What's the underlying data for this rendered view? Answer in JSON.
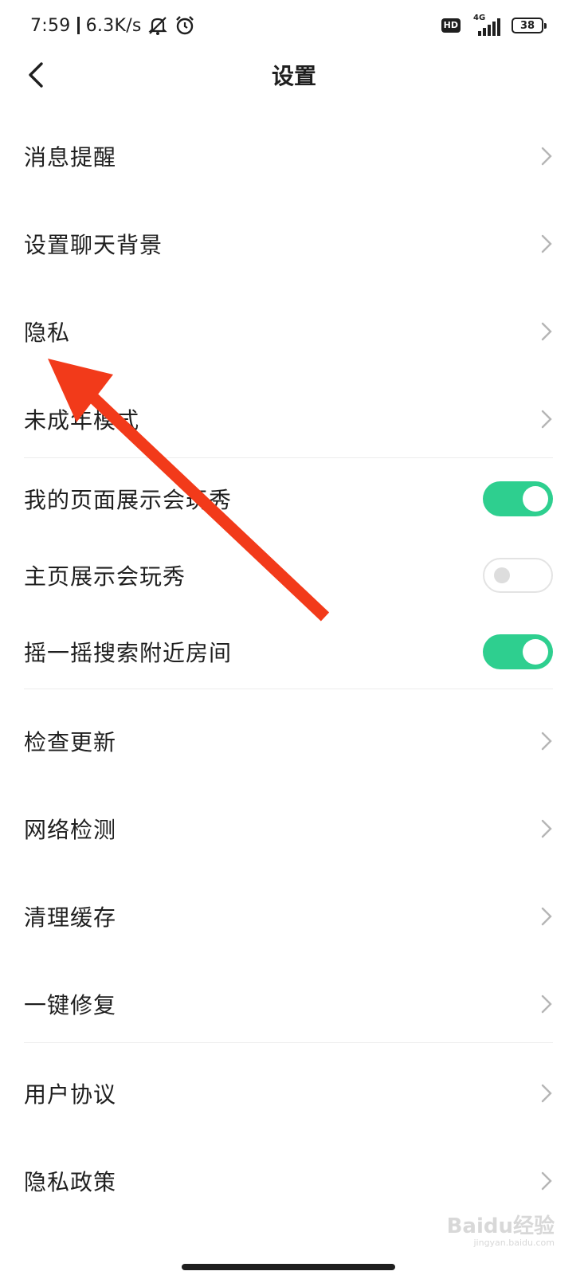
{
  "status_bar": {
    "time": "7:59",
    "net_speed": "6.3K/s",
    "hd_label": "HD",
    "network_type": "4G",
    "battery": "38",
    "icons": [
      "bell-off-icon",
      "alarm-icon",
      "signal-icon",
      "battery-icon"
    ]
  },
  "header": {
    "title": "设置",
    "back_icon": "chevron-left-icon"
  },
  "sections": [
    {
      "rows": [
        {
          "label": "消息提醒",
          "type": "link"
        },
        {
          "label": "设置聊天背景",
          "type": "link"
        },
        {
          "label": "隐私",
          "type": "link"
        },
        {
          "label": "未成年模式",
          "type": "link"
        }
      ]
    },
    {
      "rows": [
        {
          "label": "我的页面展示会玩秀",
          "type": "toggle",
          "on": true
        },
        {
          "label": "主页展示会玩秀",
          "type": "toggle",
          "on": false
        },
        {
          "label": "摇一摇搜索附近房间",
          "type": "toggle",
          "on": true
        }
      ]
    },
    {
      "rows": [
        {
          "label": "检查更新",
          "type": "link"
        },
        {
          "label": "网络检测",
          "type": "link"
        },
        {
          "label": "清理缓存",
          "type": "link"
        },
        {
          "label": "一键修复",
          "type": "link"
        }
      ]
    },
    {
      "rows": [
        {
          "label": "用户协议",
          "type": "link"
        },
        {
          "label": "隐私政策",
          "type": "link"
        }
      ]
    }
  ],
  "colors": {
    "toggle_on": "#2ecf8f",
    "annotation_arrow": "#f23a1a"
  },
  "watermark": {
    "brand": "Baidu经验",
    "url": "jingyan.baidu.com"
  }
}
